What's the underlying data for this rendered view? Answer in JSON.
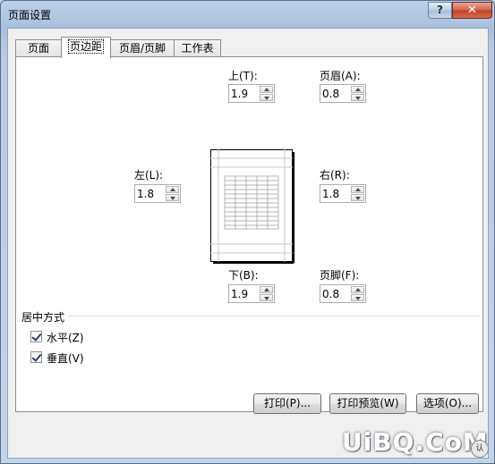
{
  "window": {
    "title": "页面设置",
    "help_label": "?",
    "close_label": "✕"
  },
  "tabs": [
    {
      "label": "页面"
    },
    {
      "label": "页边距"
    },
    {
      "label": "页眉/页脚"
    },
    {
      "label": "工作表"
    }
  ],
  "margins": {
    "top": {
      "label": "上(T):",
      "value": "1.9"
    },
    "header": {
      "label": "页眉(A):",
      "value": "0.8"
    },
    "left": {
      "label": "左(L):",
      "value": "1.8"
    },
    "right": {
      "label": "右(R):",
      "value": "1.8"
    },
    "bottom": {
      "label": "下(B):",
      "value": "1.9"
    },
    "footer": {
      "label": "页脚(F):",
      "value": "0.8"
    }
  },
  "center": {
    "title": "居中方式",
    "horizontal": {
      "label": "水平(Z)",
      "checked": true
    },
    "vertical": {
      "label": "垂直(V)",
      "checked": true
    }
  },
  "buttons": {
    "print": "打印(P)...",
    "print_preview": "打印预览(W)",
    "options": "选项(O)..."
  },
  "watermark": {
    "text": "UiBQ.CoM",
    "icon_text": "认"
  }
}
